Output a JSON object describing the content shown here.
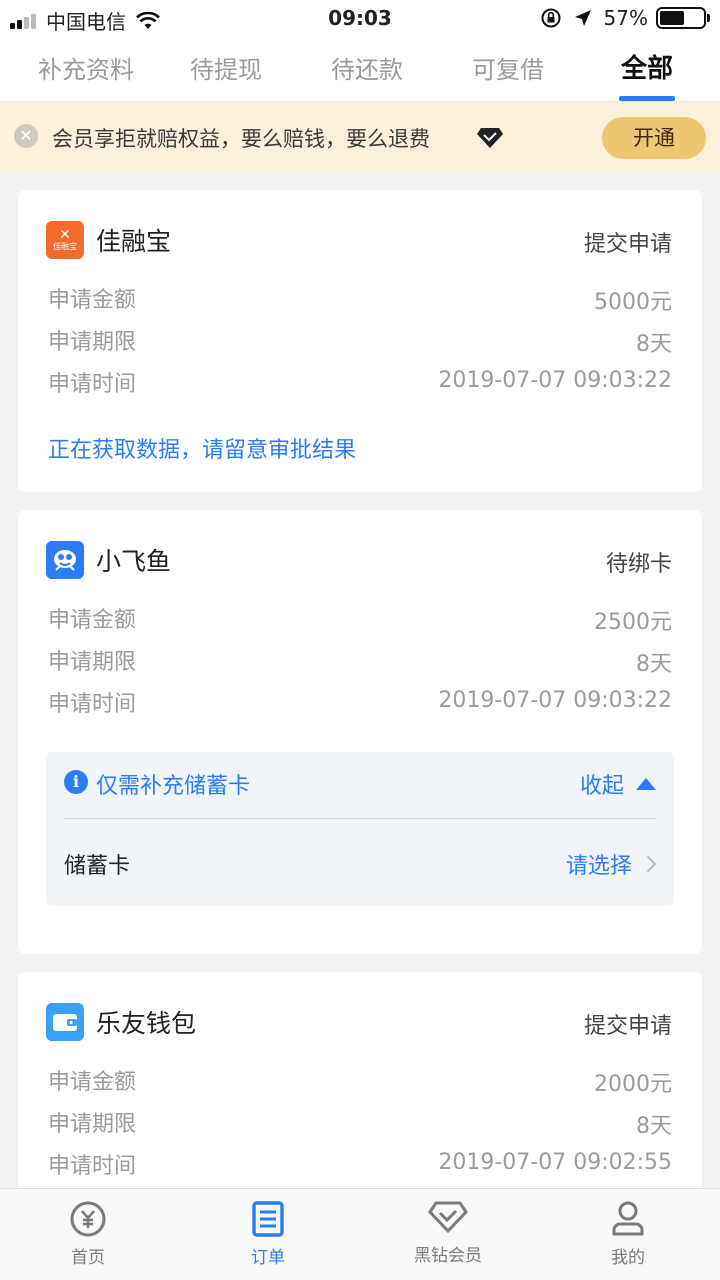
{
  "status_bar": {
    "carrier": "中国电信",
    "time": "09:03",
    "battery": "57%",
    "battery_level": 0.57
  },
  "tabs": [
    {
      "label": "补充资料",
      "active": false
    },
    {
      "label": "待提现",
      "active": false
    },
    {
      "label": "待还款",
      "active": false
    },
    {
      "label": "可复借",
      "active": false
    },
    {
      "label": "全部",
      "active": true
    }
  ],
  "banner": {
    "text": "会员享拒就赔权益，要么赔钱，要么退费",
    "button": "开通"
  },
  "orders": [
    {
      "name": "佳融宝",
      "logo_text": "佳融宝",
      "logo_color": "#f26b2a",
      "status": "提交申请",
      "rows": [
        {
          "label": "申请金额",
          "value": "5000元"
        },
        {
          "label": "申请期限",
          "value": "8天"
        },
        {
          "label": "申请时间",
          "value": "2019-07-07 09:03:22"
        }
      ],
      "hint": "正在获取数据，请留意审批结果"
    },
    {
      "name": "小飞鱼",
      "logo_color": "#2d7cf6",
      "status": "待绑卡",
      "rows": [
        {
          "label": "申请金额",
          "value": "2500元"
        },
        {
          "label": "申请期限",
          "value": "8天"
        },
        {
          "label": "申请时间",
          "value": "2019-07-07 09:03:22"
        }
      ],
      "supplement": {
        "title": "仅需补充储蓄卡",
        "toggle": "收起",
        "field_label": "储蓄卡",
        "field_value": "请选择"
      }
    },
    {
      "name": "乐友钱包",
      "logo_color": "#3aa0f5",
      "status": "提交申请",
      "rows": [
        {
          "label": "申请金额",
          "value": "2000元"
        },
        {
          "label": "申请期限",
          "value": "8天"
        },
        {
          "label": "申请时间",
          "value": "2019-07-07 09:02:55"
        }
      ]
    }
  ],
  "bottom_nav": [
    {
      "label": "首页",
      "icon": "yen-coin-icon",
      "active": false
    },
    {
      "label": "订单",
      "icon": "order-list-icon",
      "active": true
    },
    {
      "label": "黑钻会员",
      "icon": "diamond-icon",
      "active": false
    },
    {
      "label": "我的",
      "icon": "user-icon",
      "active": false
    }
  ],
  "colors": {
    "accent": "#2d7cf6",
    "banner_bg": "#fbf1db",
    "banner_button": "#efc772"
  }
}
